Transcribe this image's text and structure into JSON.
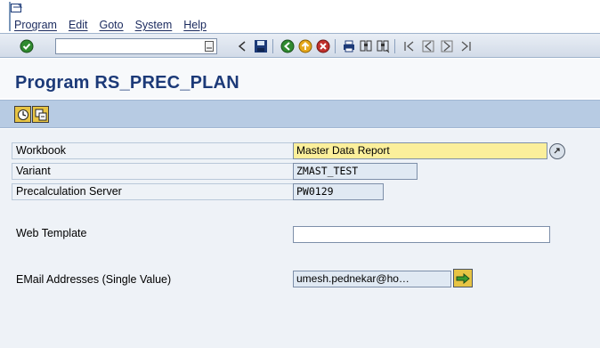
{
  "menu": {
    "items": [
      "Program",
      "Edit",
      "Goto",
      "System",
      "Help"
    ]
  },
  "toolbar": {
    "command_field_value": "",
    "icons": [
      "enter-icon",
      "command-dropdown-icon",
      "back-arrow-icon",
      "save-icon",
      "back-icon",
      "exit-icon",
      "cancel-icon",
      "print-icon",
      "find-icon",
      "find-next-icon",
      "first-page-icon",
      "previous-page-icon",
      "next-page-icon",
      "last-page-icon"
    ]
  },
  "title": "Program RS_PREC_PLAN",
  "app_toolbar": {
    "buttons": [
      "execute-icon",
      "get-variant-icon"
    ]
  },
  "form": {
    "rows": [
      {
        "label": "Workbook",
        "value": "Master Data Report"
      },
      {
        "label": "Variant",
        "value": "ZMAST_TEST"
      },
      {
        "label": "Precalculation Server",
        "value": "PW0129"
      },
      {
        "label": "Web Template",
        "value": ""
      },
      {
        "label": "EMail Addresses (Single Value)",
        "value": "umesh.pednekar@ho…"
      }
    ]
  },
  "colors": {
    "title": "#1c3a78",
    "required_field": "#fbef9b",
    "app_toolbar": "#b7cbe3"
  }
}
